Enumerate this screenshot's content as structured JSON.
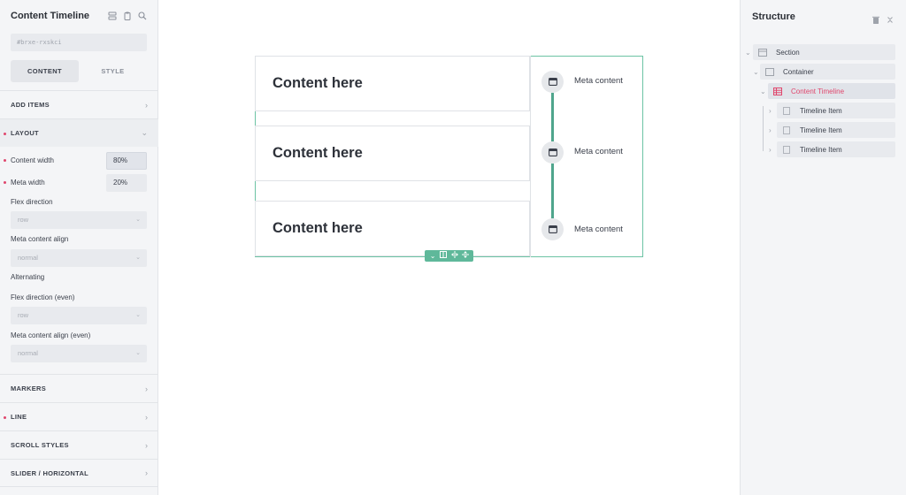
{
  "left_panel": {
    "title": "Content Timeline",
    "element_id": "#brxe-rxskci",
    "tabs": [
      {
        "label": "CONTENT",
        "active": true
      },
      {
        "label": "STYLE",
        "active": false
      }
    ],
    "sections": {
      "add_items": "ADD ITEMS",
      "layout": "LAYOUT",
      "markers": "MARKERS",
      "line": "LINE",
      "scroll_styles": "SCROLL STYLES",
      "slider": "SLIDER / HORIZONTAL"
    },
    "fields": {
      "content_width_label": "Content width",
      "content_width_value": "80%",
      "meta_width_label": "Meta width",
      "meta_width_value": "20%",
      "flex_direction_label": "Flex direction",
      "flex_direction_value": "row",
      "meta_align_label": "Meta content align",
      "meta_align_value": "normal",
      "alternating_label": "Alternating",
      "flex_direction_even_label": "Flex direction (even)",
      "flex_direction_even_value": "row",
      "meta_align_even_label": "Meta content align (even)",
      "meta_align_even_value": "normal"
    },
    "accent_color": "#e0476d"
  },
  "canvas": {
    "items": [
      {
        "content": "Content here",
        "meta": "Meta content"
      },
      {
        "content": "Content here",
        "meta": "Meta content"
      },
      {
        "content": "Content here",
        "meta": "Meta content"
      }
    ],
    "outline_color": "#6cc3a4",
    "line_color": "#4fa58c",
    "toolbar_icons": [
      "chevron-down-icon",
      "columns-icon",
      "horizontal-resize-icon",
      "vertical-resize-icon"
    ]
  },
  "right_panel": {
    "title": "Structure",
    "tree": [
      {
        "label": "Section",
        "icon": "section-icon"
      },
      {
        "label": "Container",
        "icon": "container-icon"
      },
      {
        "label": "Content Timeline",
        "icon": "timeline-icon",
        "active": true
      },
      {
        "label": "Timeline Item",
        "icon": "item-icon"
      },
      {
        "label": "Timeline Item",
        "icon": "item-icon"
      },
      {
        "label": "Timeline Item",
        "icon": "item-icon"
      }
    ]
  }
}
